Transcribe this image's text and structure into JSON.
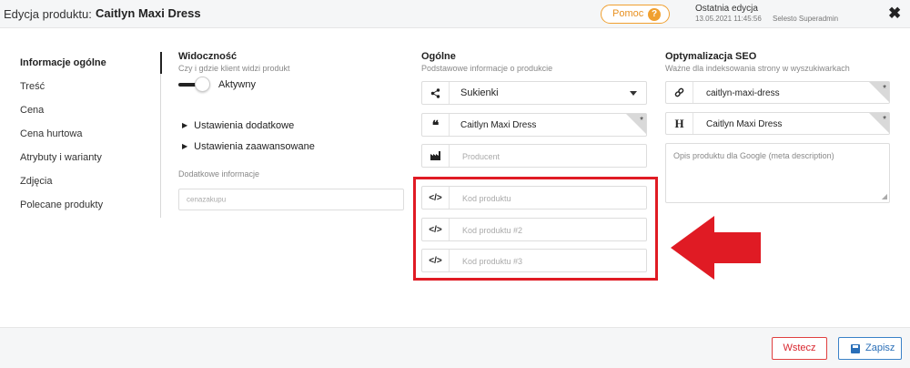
{
  "header": {
    "label": "Edycja produktu:",
    "product_name": "Caitlyn Maxi Dress",
    "help_label": "Pomoc",
    "help_icon": "?",
    "last_edit_label": "Ostatnia edycja",
    "last_edit_date": "13.05.2021 11:45:56",
    "last_edit_user": "Selesto Superadmin",
    "close_icon": "close-icon"
  },
  "sidebar": {
    "items": [
      {
        "label": "Informacje ogólne",
        "active": true
      },
      {
        "label": "Treść"
      },
      {
        "label": "Cena"
      },
      {
        "label": "Cena hurtowa"
      },
      {
        "label": "Atrybuty i warianty"
      },
      {
        "label": "Zdjęcia"
      },
      {
        "label": "Polecane produkty"
      }
    ]
  },
  "visibility": {
    "title": "Widoczność",
    "subtitle": "Czy i gdzie klient widzi produkt",
    "toggle_label": "Aktywny",
    "toggle_on": true,
    "expander_1": "Ustawienia dodatkowe",
    "expander_2": "Ustawienia zaawansowane",
    "extra_label": "Dodatkowe informacje",
    "extra_placeholder": "cenazakupu"
  },
  "general": {
    "title": "Ogólne",
    "subtitle": "Podstawowe informacje o produkcie",
    "category_value": "Sukienki",
    "name_value": "Caitlyn Maxi Dress",
    "producer_placeholder": "Producent",
    "code1_placeholder": "Kod produktu",
    "code2_placeholder": "Kod produktu #2",
    "code3_placeholder": "Kod produktu #3",
    "required_mark": "*"
  },
  "seo": {
    "title": "Optymalizacja SEO",
    "subtitle": "Ważne dla indeksowania strony w wyszukiwarkach",
    "slug_value": "caitlyn-maxi-dress",
    "heading_value": "Caitlyn Maxi Dress",
    "description_placeholder": "Opis produktu dla Google (meta description)"
  },
  "icons": {
    "share": "share-icon",
    "quote": "quote-icon",
    "factory": "factory-icon",
    "code": "code-icon",
    "link": "link-icon",
    "heading": "heading-icon",
    "disk": "floppy-disk-icon"
  },
  "colors": {
    "accent_orange": "#f0a030",
    "highlight_red": "#e01b24",
    "save_blue": "#2a6fb8",
    "back_red": "#d8262e"
  },
  "footer": {
    "back_label": "Wstecz",
    "save_label": "Zapisz"
  }
}
